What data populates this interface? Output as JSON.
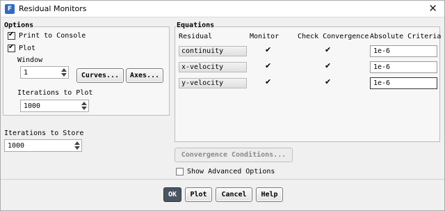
{
  "window": {
    "title": "Residual Monitors",
    "icon": "F",
    "close_glyph": "✕"
  },
  "options": {
    "group_label": "Options",
    "print_to_console": {
      "label": "Print to Console",
      "checked": true
    },
    "plot": {
      "label": "Plot",
      "checked": true
    },
    "window_label": "Window",
    "window_value": "1",
    "curves_button": "Curves...",
    "axes_button": "Axes...",
    "iterations_to_plot_label": "Iterations to Plot",
    "iterations_to_plot_value": "1000"
  },
  "iterations_to_store": {
    "label": "Iterations to Store",
    "value": "1000"
  },
  "equations": {
    "group_label": "Equations",
    "headers": {
      "residual": "Residual",
      "monitor": "Monitor",
      "check": "Check Convergence",
      "criteria": "Absolute Criteria"
    },
    "rows": [
      {
        "name": "continuity",
        "monitor": true,
        "check": true,
        "criteria": "1e-6"
      },
      {
        "name": "x-velocity",
        "monitor": true,
        "check": true,
        "criteria": "1e-6"
      },
      {
        "name": "y-velocity",
        "monitor": true,
        "check": true,
        "criteria": "1e-6"
      }
    ]
  },
  "convergence_conditions_button": "Convergence Conditions...",
  "show_advanced": {
    "label": "Show Advanced Options",
    "checked": false
  },
  "footer": {
    "ok": "OK",
    "plot": "Plot",
    "cancel": "Cancel",
    "help": "Help"
  },
  "colors": {
    "primary_button": "#4a5563",
    "app_icon": "#2d6cc0"
  }
}
